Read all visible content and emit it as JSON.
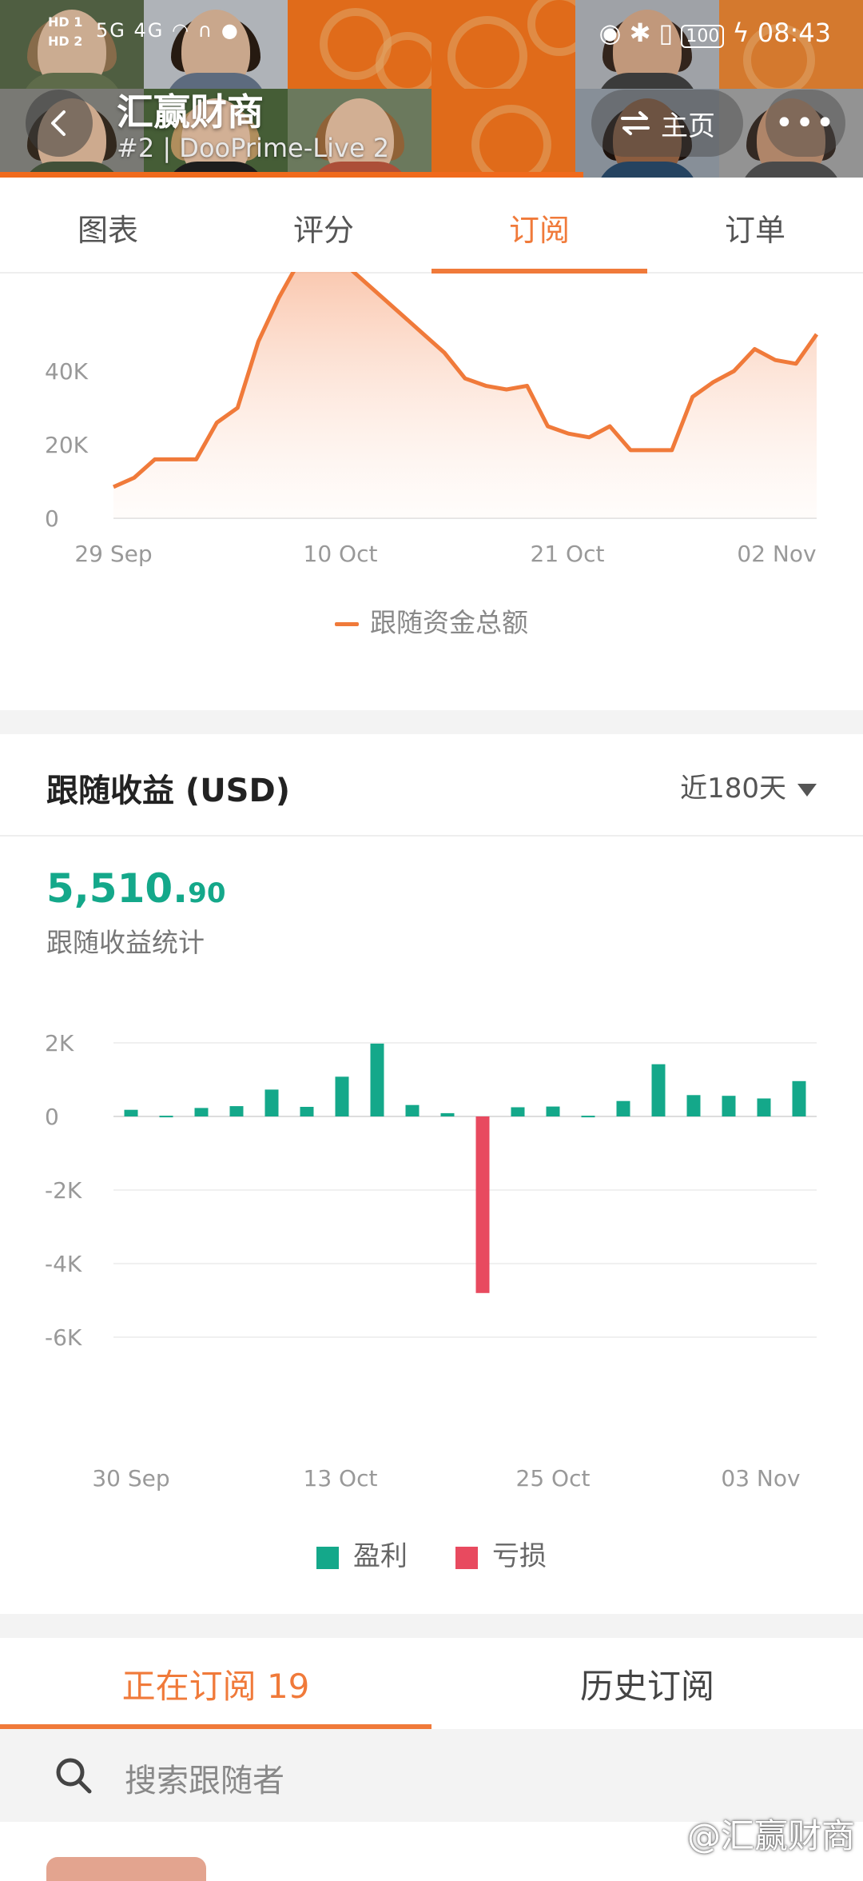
{
  "status_bar": {
    "hd1": "HD 1",
    "hd2": "HD 2",
    "signal": "5G 4G",
    "battery": "100",
    "time": "08:43"
  },
  "header": {
    "title": "汇赢财商",
    "subtitle": "#2 | DooPrime-Live 2",
    "home_label": "主页",
    "more_label": "•••"
  },
  "tabs": [
    {
      "label": "图表",
      "active": false
    },
    {
      "label": "评分",
      "active": false
    },
    {
      "label": "订阅",
      "active": true
    },
    {
      "label": "订单",
      "active": false
    }
  ],
  "chart_data": [
    {
      "type": "area",
      "y_ticks": [
        "40K",
        "20K",
        "0"
      ],
      "ylim": [
        0,
        45000
      ],
      "x_tick_labels": [
        "29 Sep",
        "10 Oct",
        "21 Oct",
        "02 Nov"
      ],
      "legend": [
        "跟随资金总额"
      ],
      "color": "#f07a3a",
      "series": [
        {
          "name": "跟随资金总额",
          "x": [
            "29 Sep",
            "30 Sep",
            "01 Oct",
            "02 Oct",
            "03 Oct",
            "04 Oct",
            "05 Oct",
            "06 Oct",
            "07 Oct",
            "08 Oct",
            "09 Oct",
            "10 Oct",
            "11 Oct",
            "12 Oct",
            "13 Oct",
            "14 Oct",
            "15 Oct",
            "16 Oct",
            "17 Oct",
            "18 Oct",
            "19 Oct",
            "20 Oct",
            "21 Oct",
            "22 Oct",
            "23 Oct",
            "24 Oct",
            "25 Oct",
            "26 Oct",
            "27 Oct",
            "28 Oct",
            "29 Oct",
            "30 Oct",
            "31 Oct",
            "01 Nov",
            "02 Nov"
          ],
          "values": [
            8500,
            11000,
            16000,
            16000,
            16000,
            26000,
            30000,
            48000,
            60000,
            70000,
            75000,
            70000,
            65000,
            60000,
            55000,
            50000,
            45000,
            38000,
            36000,
            35000,
            36000,
            25000,
            23000,
            22000,
            25000,
            18500,
            18500,
            18500,
            33000,
            37000,
            40000,
            46000,
            43000,
            42000,
            50000
          ]
        }
      ]
    },
    {
      "type": "bar",
      "y_ticks": [
        "2K",
        "0",
        "-2K",
        "-4K",
        "-6K"
      ],
      "ylim": [
        -6000,
        2000
      ],
      "x_tick_labels": [
        "30 Sep",
        "13 Oct",
        "25 Oct",
        "03 Nov"
      ],
      "legend": [
        {
          "label": "盈利",
          "color": "#14a88a"
        },
        {
          "label": "亏损",
          "color": "#e84a5f"
        }
      ],
      "values": [
        180,
        20,
        230,
        280,
        730,
        260,
        1080,
        1980,
        310,
        90,
        -4800,
        250,
        270,
        20,
        420,
        1420,
        580,
        560,
        490,
        960
      ]
    }
  ],
  "earnings": {
    "title": "跟随收益 (USD)",
    "period": "近180天",
    "total_big": "5,510.",
    "total_small": "90",
    "total_label": "跟随收益统计"
  },
  "subscriptions": {
    "tabs": [
      {
        "label": "正在订阅 19",
        "active": true
      },
      {
        "label": "历史订阅",
        "active": false
      }
    ],
    "search_placeholder": "搜索跟随者"
  },
  "watermark": "@汇赢财商"
}
